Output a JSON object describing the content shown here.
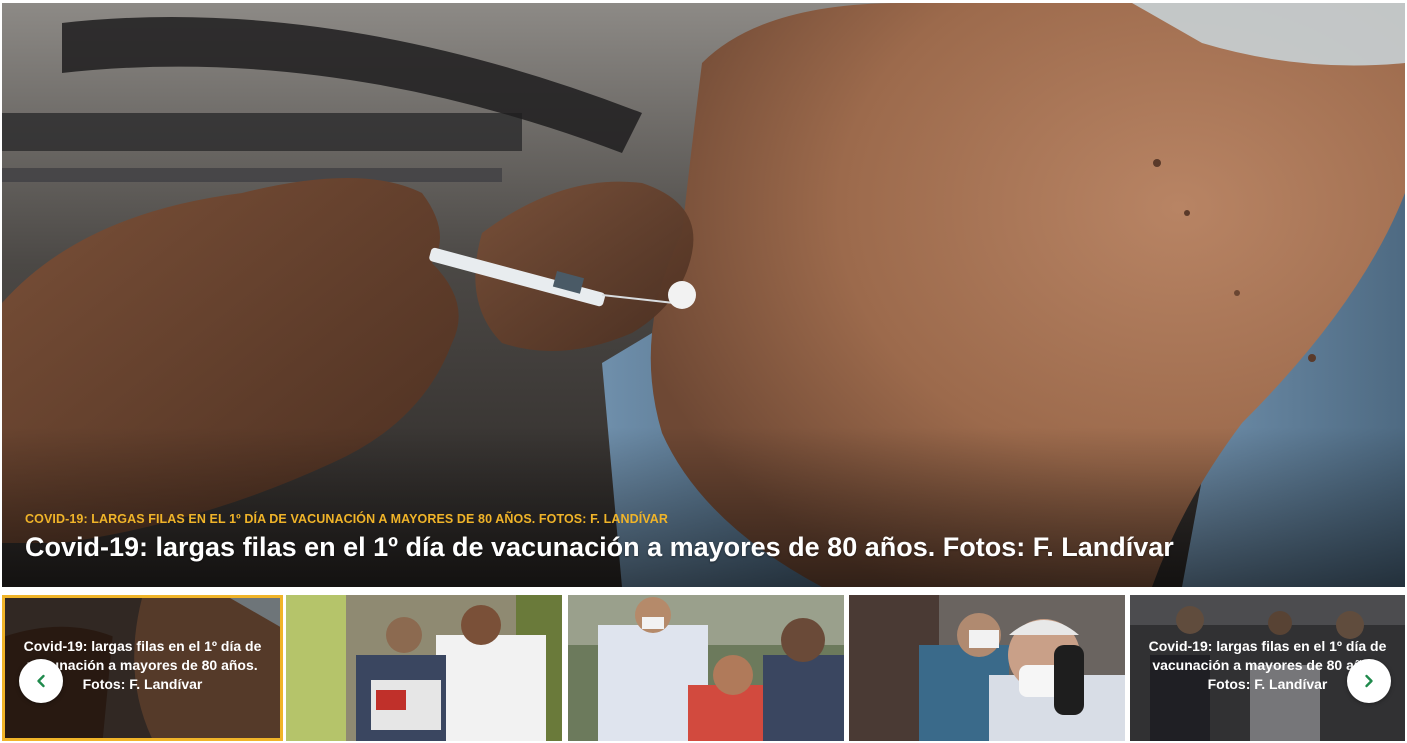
{
  "hero": {
    "category": "COVID-19: LARGAS FILAS EN EL 1º DÍA DE VACUNACIÓN A MAYORES DE 80 AÑOS. FOTOS: F. LANDÍVAR",
    "title": "Covid-19: largas filas en el 1º día de vacunación a mayores de 80 años. Fotos: F. Landívar"
  },
  "thumbnails": [
    {
      "caption": "Covid-19: largas filas en el 1º día de vacunación a mayores de 80 años. Fotos: F. Landívar",
      "active": true
    },
    {
      "caption": "",
      "active": false
    },
    {
      "caption": "",
      "active": false
    },
    {
      "caption": "",
      "active": false
    },
    {
      "caption": "Covid-19: largas filas en el 1º día de vacunación a mayores de 80 años. Fotos: F. Landívar",
      "active": false
    }
  ],
  "navigation": {
    "prev_icon": "chevron-left-icon",
    "next_icon": "chevron-right-icon"
  },
  "colors": {
    "accent": "#f0b429",
    "arrow": "#1f8a4c"
  }
}
